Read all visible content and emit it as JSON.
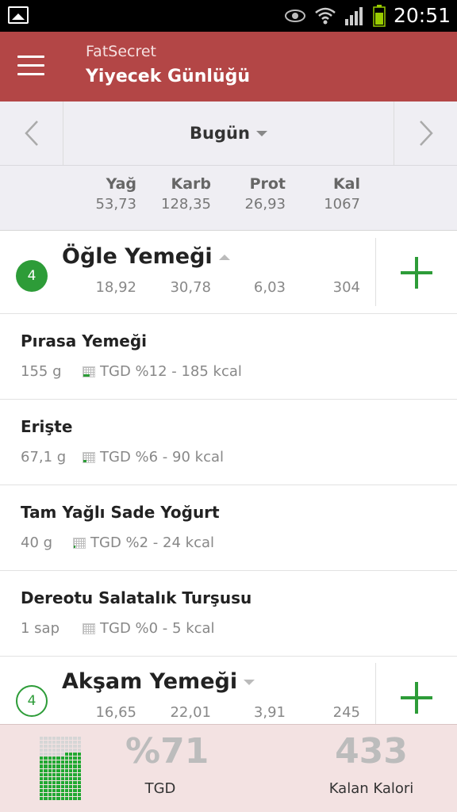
{
  "status_bar": {
    "time": "20:51"
  },
  "app_bar": {
    "app_name": "FatSecret",
    "title": "Yiyecek Günlüğü"
  },
  "date_nav": {
    "label": "Bugün"
  },
  "totals": {
    "fat": {
      "label": "Yağ",
      "value": "53,73"
    },
    "carb": {
      "label": "Karb",
      "value": "128,35"
    },
    "prot": {
      "label": "Prot",
      "value": "26,93"
    },
    "kal": {
      "label": "Kal",
      "value": "1067"
    }
  },
  "meals": [
    {
      "badge": "4",
      "name": "Öğle Yemeği",
      "fat": "18,92",
      "carb": "30,78",
      "prot": "6,03",
      "kal": "304",
      "items": [
        {
          "name": "Pırasa Yemeği",
          "qty": "155  g",
          "rdi": "TGD %12 - 185 kcal"
        },
        {
          "name": "Erişte",
          "qty": "67,1  g",
          "rdi": "TGD %6 - 90 kcal"
        },
        {
          "name": "Tam Yağlı Sade Yoğurt",
          "qty": "40  g",
          "rdi": "TGD %2 - 24 kcal"
        },
        {
          "name": "Dereotu Salatalık Turşusu",
          "qty": "1  sap",
          "rdi": "TGD %0 - 5 kcal"
        }
      ]
    },
    {
      "badge": "4",
      "name": "Akşam Yemeği",
      "fat": "16,65",
      "carb": "22,01",
      "prot": "3,91",
      "kal": "245"
    }
  ],
  "footer": {
    "rdi_percent": "%71",
    "rdi_label": "TGD",
    "rdi_fraction": 0.71,
    "remaining": "433",
    "remaining_label": "Kalan Kalori"
  },
  "colors": {
    "app_bar": "#b34646",
    "accent_green": "#2d9c38",
    "footer_bg": "#f3e2e2"
  }
}
